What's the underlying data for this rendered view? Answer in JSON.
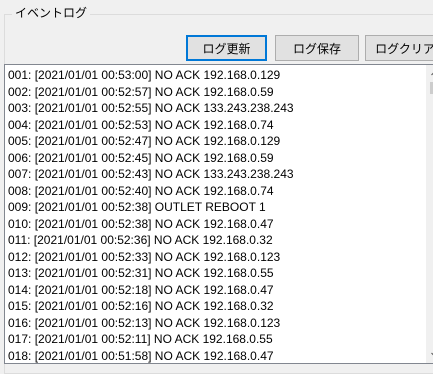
{
  "group": {
    "title": "イベントログ"
  },
  "buttons": {
    "update_label": "ログ更新",
    "save_label": "ログ保存",
    "clear_label": "ログクリア"
  },
  "log": {
    "entries": [
      "001: [2021/01/01 00:53:00] NO ACK 192.168.0.129",
      "002: [2021/01/01 00:52:57] NO ACK 192.168.0.59",
      "003: [2021/01/01 00:52:55] NO ACK 133.243.238.243",
      "004: [2021/01/01 00:52:53] NO ACK 192.168.0.74",
      "005: [2021/01/01 00:52:47] NO ACK 192.168.0.129",
      "006: [2021/01/01 00:52:45] NO ACK 192.168.0.59",
      "007: [2021/01/01 00:52:43] NO ACK 133.243.238.243",
      "008: [2021/01/01 00:52:40] NO ACK 192.168.0.74",
      "009: [2021/01/01 00:52:38] OUTLET REBOOT 1",
      "010: [2021/01/01 00:52:38] NO ACK 192.168.0.47",
      "011: [2021/01/01 00:52:36] NO ACK 192.168.0.32",
      "012: [2021/01/01 00:52:33] NO ACK 192.168.0.123",
      "013: [2021/01/01 00:52:31] NO ACK 192.168.0.55",
      "014: [2021/01/01 00:52:18] NO ACK 192.168.0.47",
      "015: [2021/01/01 00:52:16] NO ACK 192.168.0.32",
      "016: [2021/01/01 00:52:13] NO ACK 192.168.0.123",
      "017: [2021/01/01 00:52:11] NO ACK 192.168.0.55",
      "018: [2021/01/01 00:51:58] NO ACK 192.168.0.47"
    ]
  },
  "icons": {
    "scroll_up": "chevron-up-icon",
    "scroll_down": "chevron-down-icon"
  },
  "colors": {
    "focus_border": "#0078d7",
    "list_background": "#ffffff",
    "window_background": "#f0f0f0"
  }
}
